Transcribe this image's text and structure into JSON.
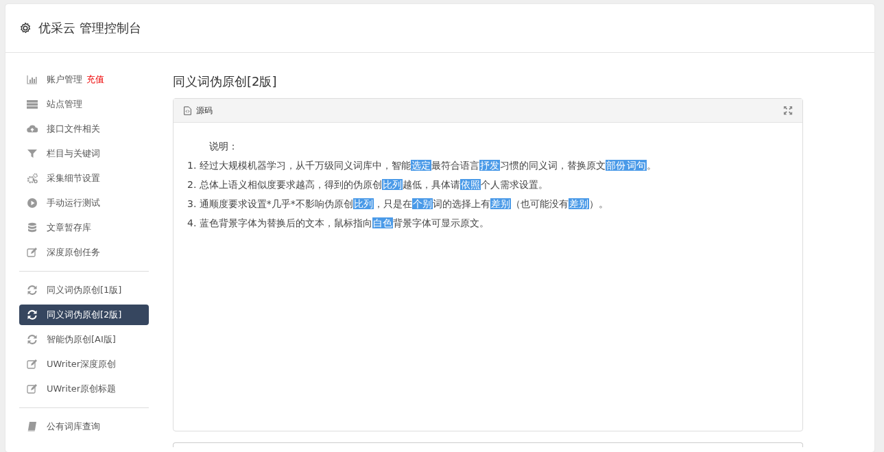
{
  "header": {
    "title": "优采云 管理控制台"
  },
  "sidebar": {
    "groups": [
      {
        "items": [
          {
            "kind": "chart",
            "label": "账户管理",
            "badge": "充值",
            "selected": false
          },
          {
            "kind": "server",
            "label": "站点管理",
            "selected": false
          },
          {
            "kind": "cloud",
            "label": "接口文件相关",
            "selected": false
          },
          {
            "kind": "filter",
            "label": "栏目与关键词",
            "selected": false
          },
          {
            "kind": "gears",
            "label": "采集细节设置",
            "selected": false
          },
          {
            "kind": "play",
            "label": "手动运行测试",
            "selected": false
          },
          {
            "kind": "database",
            "label": "文章暂存库",
            "selected": false
          },
          {
            "kind": "edit",
            "label": "深度原创任务",
            "selected": false
          }
        ]
      },
      {
        "items": [
          {
            "kind": "refresh",
            "label": "同义词伪原创[1版]",
            "selected": false
          },
          {
            "kind": "refresh",
            "label": "同义词伪原创[2版]",
            "selected": true
          },
          {
            "kind": "refresh",
            "label": "智能伪原创[AI版]",
            "selected": false
          },
          {
            "kind": "edit",
            "label": "UWriter深度原创",
            "selected": false
          },
          {
            "kind": "edit",
            "label": "UWriter原创标题",
            "selected": false
          }
        ]
      },
      {
        "items": [
          {
            "kind": "book",
            "label": "公有词库查询",
            "selected": false
          }
        ]
      }
    ]
  },
  "main": {
    "title": "同义词伪原创[2版]",
    "panel": {
      "title": "源码",
      "heading": "说明：",
      "lines": [
        [
          {
            "text": "1. 经过大规模机器学习，从千万级同义词库中，智能",
            "highlight": false
          },
          {
            "text": "选定",
            "highlight": true
          },
          {
            "text": "最符合语言",
            "highlight": false
          },
          {
            "text": "抒发",
            "highlight": true
          },
          {
            "text": "习惯的同义词，替换原文",
            "highlight": false
          },
          {
            "text": "部份",
            "highlight": true
          },
          {
            "text": "词句",
            "highlight": true
          },
          {
            "text": "。",
            "highlight": false
          }
        ],
        [
          {
            "text": "2. 总体上语义相似度要求越高，得到的伪原创",
            "highlight": false
          },
          {
            "text": "比列",
            "highlight": true
          },
          {
            "text": "越低，具体请",
            "highlight": false
          },
          {
            "text": "依照",
            "highlight": true
          },
          {
            "text": "个人需求设置。",
            "highlight": false
          }
        ],
        [
          {
            "text": "3. 通顺度要求设置*几乎*不影响伪原创",
            "highlight": false
          },
          {
            "text": "比列",
            "highlight": true
          },
          {
            "text": "，只是在",
            "highlight": false
          },
          {
            "text": "个别",
            "highlight": true
          },
          {
            "text": "词的选择上有",
            "highlight": false
          },
          {
            "text": "差别",
            "highlight": true
          },
          {
            "text": "（也可能没有",
            "highlight": false
          },
          {
            "text": "差别",
            "highlight": true
          },
          {
            "text": "）。",
            "highlight": false
          }
        ],
        [
          {
            "text": "4. 蓝色背景字体为替换后的文本，鼠标指向",
            "highlight": false
          },
          {
            "text": "白色",
            "highlight": true
          },
          {
            "text": "背景字体可显示原文。",
            "highlight": false
          }
        ]
      ]
    }
  }
}
